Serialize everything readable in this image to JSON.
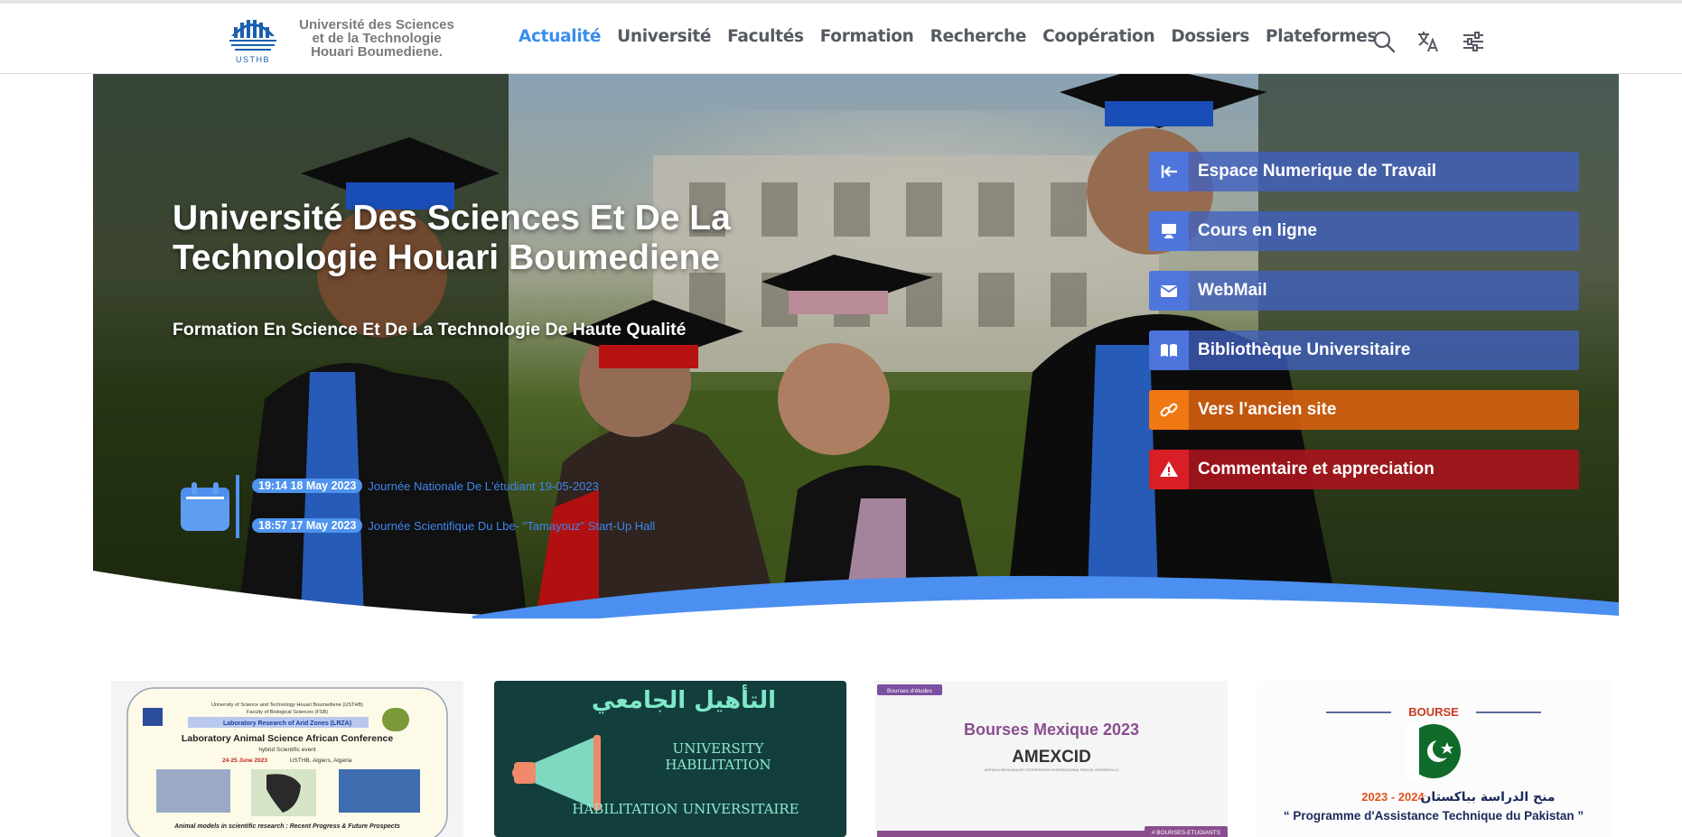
{
  "header": {
    "brand_lines": [
      "Université des Sciences",
      "et de la Technologie",
      "Houari Boumediene."
    ],
    "logo_text": "USTHB",
    "nav": [
      {
        "label": "Actualité",
        "active": true
      },
      {
        "label": "Université",
        "active": false
      },
      {
        "label": "Facultés",
        "active": false
      },
      {
        "label": "Formation",
        "active": false
      },
      {
        "label": "Recherche",
        "active": false
      },
      {
        "label": "Coopération",
        "active": false
      },
      {
        "label": "Dossiers",
        "active": false
      },
      {
        "label": "Plateformes",
        "active": false
      }
    ],
    "tools": [
      "search-icon",
      "translate-icon",
      "settings-sliders-icon"
    ]
  },
  "hero": {
    "title": "Université Des Sciences Et De La Technologie Houari Boumediene",
    "subtitle": "Formation En Science Et De La Technologie De Haute Qualité",
    "news": [
      {
        "date": "19:14 18 May 2023",
        "text": "Journée Nationale De L'étudiant 19-05-2023"
      },
      {
        "date": "18:57 17 May 2023",
        "text": "Journée Scientifique Du Lbe- \"Tamayouz\" Start-Up Hall"
      }
    ],
    "quick_links": [
      {
        "label": "Espace Numerique de Travail",
        "icon": "login-arrow-icon",
        "style": "blue"
      },
      {
        "label": "Cours en ligne",
        "icon": "monitor-icon",
        "style": "blue"
      },
      {
        "label": "WebMail",
        "icon": "mail-icon",
        "style": "blue"
      },
      {
        "label": "Bibliothèque Universitaire",
        "icon": "book-icon",
        "style": "blue"
      },
      {
        "label": "Vers l'ancien site",
        "icon": "link-icon",
        "style": "orange"
      },
      {
        "label": "Commentaire et appreciation",
        "icon": "warning-icon",
        "style": "red"
      }
    ]
  },
  "cards": [
    {
      "lines": [
        "University of Science and Technology Houari Boumediene (USTHB)",
        "Faculty of Biological Sciences (FSB)",
        "Laboratory Research of Arid Zones (LRZA)",
        "Laboratory Animal Science African Conference",
        "hybrid Scientific event",
        "24-25 June 2023",
        "USTHB, Algiers, Algeria",
        "Animal models in scientific research : Recent Progress & Future Prospects"
      ]
    },
    {
      "arabic": "التأهيل الجامعي",
      "en1": "UNIVERSITY",
      "en2": "HABILITATION",
      "fr": "HABILITATION UNIVERSITAIRE"
    },
    {
      "tag": "Bourses d'études",
      "title": "Bourses Mexique 2023",
      "org": "AMEXCID",
      "org_sub": "AGENCIA MEXICANA DE COOPERACIÓN INTERNACIONAL PARA EL DESARROLLO",
      "footer_tag": "# BOURSES-ETUDIANTS"
    },
    {
      "heading": "BOURSE",
      "arabic": "منح الدراسة بباكستان",
      "years": "2023 - 2024",
      "french": "“ Programme d'Assistance Technique du Pakistan ”"
    }
  ]
}
